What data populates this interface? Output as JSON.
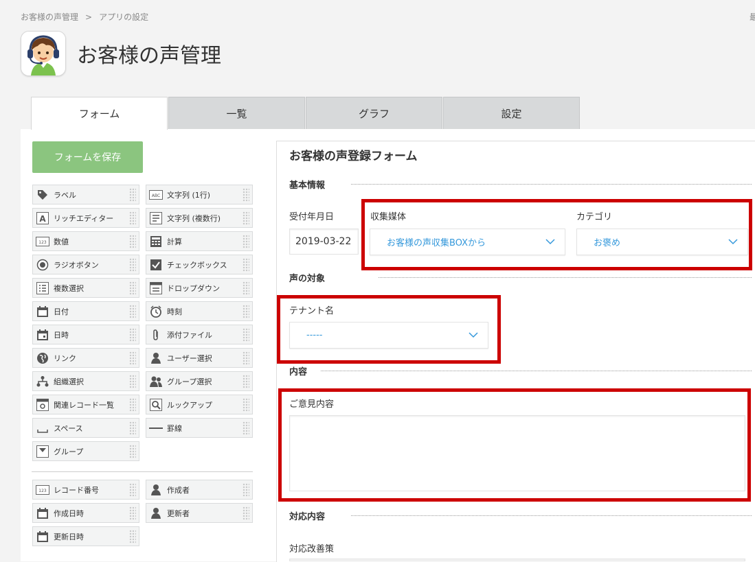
{
  "breadcrumb": {
    "root": "お客様の声管理",
    "separator": ">",
    "current": "アプリの設定"
  },
  "topright_text": "最",
  "app": {
    "title": "お客様の声管理"
  },
  "tabs": [
    "フォーム",
    "一覧",
    "グラフ",
    "設定"
  ],
  "save_button": "フォームを保存",
  "palette": [
    {
      "label": "ラベル",
      "icon": "tag-icon"
    },
    {
      "label": "文字列 (1行)",
      "icon": "abc-text-icon"
    },
    {
      "label": "リッチエディター",
      "icon": "rich-editor-icon"
    },
    {
      "label": "文字列 (複数行)",
      "icon": "multiline-text-icon"
    },
    {
      "label": "数値",
      "icon": "number-icon"
    },
    {
      "label": "計算",
      "icon": "calculator-icon"
    },
    {
      "label": "ラジオボタン",
      "icon": "radio-icon"
    },
    {
      "label": "チェックボックス",
      "icon": "checkbox-icon"
    },
    {
      "label": "複数選択",
      "icon": "multi-select-icon"
    },
    {
      "label": "ドロップダウン",
      "icon": "dropdown-icon"
    },
    {
      "label": "日付",
      "icon": "calendar-icon"
    },
    {
      "label": "時刻",
      "icon": "clock-icon"
    },
    {
      "label": "日時",
      "icon": "datetime-icon"
    },
    {
      "label": "添付ファイル",
      "icon": "paperclip-icon"
    },
    {
      "label": "リンク",
      "icon": "globe-icon"
    },
    {
      "label": "ユーザー選択",
      "icon": "user-icon"
    },
    {
      "label": "組織選択",
      "icon": "org-icon"
    },
    {
      "label": "グループ選択",
      "icon": "group-icon"
    },
    {
      "label": "関連レコード一覧",
      "icon": "related-records-icon"
    },
    {
      "label": "ルックアップ",
      "icon": "lookup-icon"
    },
    {
      "label": "スペース",
      "icon": "space-icon"
    },
    {
      "label": "罫線",
      "icon": "line-icon"
    },
    {
      "label": "グループ",
      "icon": "group-field-icon"
    }
  ],
  "system_palette": [
    {
      "label": "レコード番号",
      "icon": "number-icon"
    },
    {
      "label": "作成者",
      "icon": "user-icon"
    },
    {
      "label": "作成日時",
      "icon": "calendar-icon"
    },
    {
      "label": "更新者",
      "icon": "user-icon"
    },
    {
      "label": "更新日時",
      "icon": "calendar-icon"
    }
  ],
  "form": {
    "title": "お客様の声登録フォーム",
    "sections": {
      "basic": "基本情報",
      "target": "声の対象",
      "content": "内容",
      "response": "対応内容"
    },
    "fields": {
      "date_label": "受付年月日",
      "date_value": "2019-03-22",
      "media_label": "収集媒体",
      "media_value": "お客様の声収集BOXから",
      "category_label": "カテゴリ",
      "category_value": "お褒め",
      "tenant_label": "テナント名",
      "tenant_value": "-----",
      "opinion_label": "ご意見内容",
      "improvement_label": "対応改善策"
    }
  },
  "colors": {
    "highlight": "#cc0000",
    "save_button": "#8bc57f",
    "select_text": "#3498db"
  }
}
